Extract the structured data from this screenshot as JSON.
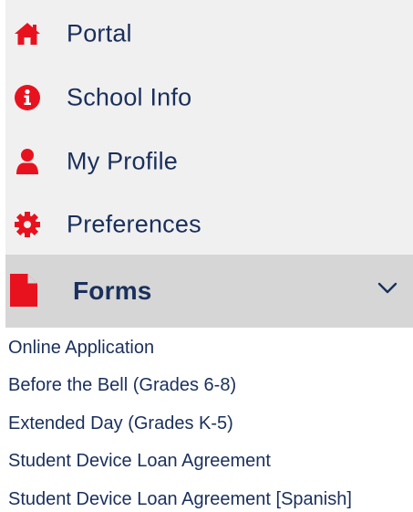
{
  "colors": {
    "accent_red": "#e8121f",
    "text_navy": "#1a2f5c",
    "menu_bg": "#f0f0f0",
    "active_bg": "#d6d6d6"
  },
  "menu": {
    "items": [
      {
        "label": "Portal",
        "icon": "home-icon"
      },
      {
        "label": "School Info",
        "icon": "info-circle-icon"
      },
      {
        "label": "My Profile",
        "icon": "user-icon"
      },
      {
        "label": "Preferences",
        "icon": "gear-icon"
      }
    ],
    "forms": {
      "label": "Forms",
      "icon": "document-icon",
      "toggle_icon": "chevron-down-icon",
      "expanded": true,
      "links": [
        {
          "label": "Online Application"
        },
        {
          "label": "Before the Bell (Grades 6-8)"
        },
        {
          "label": "Extended Day (Grades K-5)"
        },
        {
          "label": "Student Device Loan Agreement"
        },
        {
          "label": "Student Device Loan Agreement [Spanish]"
        }
      ]
    }
  }
}
